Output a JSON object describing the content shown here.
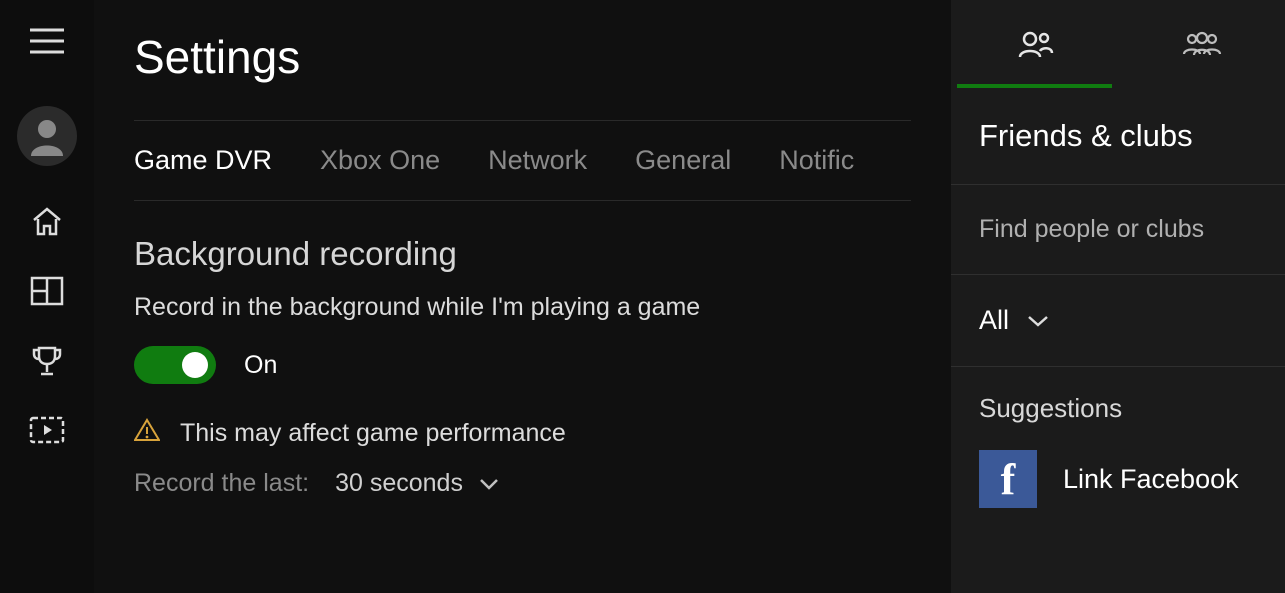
{
  "header": {
    "title": "Settings"
  },
  "tabs": {
    "items": [
      {
        "label": "Game DVR",
        "active": true
      },
      {
        "label": "Xbox One"
      },
      {
        "label": "Network"
      },
      {
        "label": "General"
      },
      {
        "label": "Notific"
      }
    ]
  },
  "background_recording": {
    "heading": "Background recording",
    "description": "Record in the background while I'm playing a game",
    "toggle_state": "On",
    "warning": "This may affect game performance",
    "record_label": "Record the last:",
    "record_value": "30 seconds"
  },
  "rightpane": {
    "friends_title": "Friends & clubs",
    "find_placeholder": "Find people or clubs",
    "filter_label": "All",
    "suggestions_title": "Suggestions",
    "facebook_label": "Link Facebook"
  }
}
